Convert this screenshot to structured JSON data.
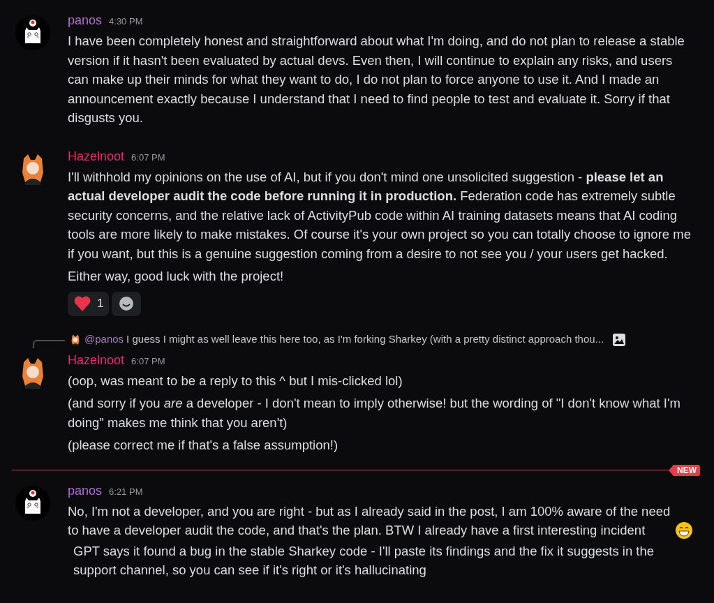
{
  "messages": [
    {
      "author": "panos",
      "color": "#b06fd0",
      "time": "4:30 PM",
      "avatar": {
        "kind": "cat"
      },
      "paragraphs": [
        {
          "text": "I have been completely honest and straightforward about what I'm doing, and do not plan to release a stable version if it hasn't been evaluated by actual devs. Even then, I will continue to explain any risks, and users can make up their minds for what they want to do, I do not plan to force anyone to use it. And I made an announcement exactly because I understand that I need to find people to test and evaluate it. Sorry if that disgusts you."
        }
      ]
    },
    {
      "author": "Hazelnoot",
      "color": "#ec2a6a",
      "time": "6:07 PM",
      "avatar": {
        "kind": "fox"
      },
      "paragraphs": [
        {
          "text": "I'll withhold my opinions on the use of AI, but if you don't mind one unsolicited suggestion - **please let an actual developer audit the code before running it in production.** Federation code has extremely subtle security concerns, and the relative lack of ActivityPub code within AI training datasets means that AI coding tools are more likely to make mistakes. Of course it's your own project so you can totally choose to ignore me if you want, but this is a genuine suggestion coming from a desire to not see you / your users get hacked."
        },
        {
          "text": "Either way, good luck with the project!"
        }
      ],
      "reactions": [
        {
          "kind": "heart",
          "count": "1"
        },
        {
          "kind": "add"
        }
      ]
    },
    {
      "author": "Hazelnoot",
      "color": "#ec2a6a",
      "time": "6:07 PM",
      "avatar": {
        "kind": "fox"
      },
      "reply": {
        "author": "@panos",
        "text": "I guess I might as well leave this here too, as I'm forking Sharkey (with a pretty distinct approach thou..."
      },
      "paragraphs": [
        {
          "text": "(oop, was meant to be a reply to this ^ but I mis-clicked lol)"
        },
        {
          "text": "(and sorry if you *are* a developer - I don't mean to imply otherwise! but the wording of \"I don't know what I'm doing\" makes me think that you aren't)"
        },
        {
          "text": "(please correct me if that's a false assumption!)"
        }
      ]
    },
    {
      "author": "panos",
      "color": "#b06fd0",
      "time": "6:21 PM",
      "avatar": {
        "kind": "cat"
      },
      "new_marker": "NEW",
      "paragraphs": [
        {
          "text": "No, I'm not a developer, and you are right - but as I already said in the post, I am 100% aware of the need to have a developer audit the code, and that's the plan. BTW I already have a first interesting incident",
          "emoji_after": true
        },
        {
          "text": "GPT says it found a bug in the stable Sharkey code - I'll paste its findings and the fix it suggests in the support channel, so you can see if it's right or it's hallucinating"
        }
      ]
    }
  ]
}
